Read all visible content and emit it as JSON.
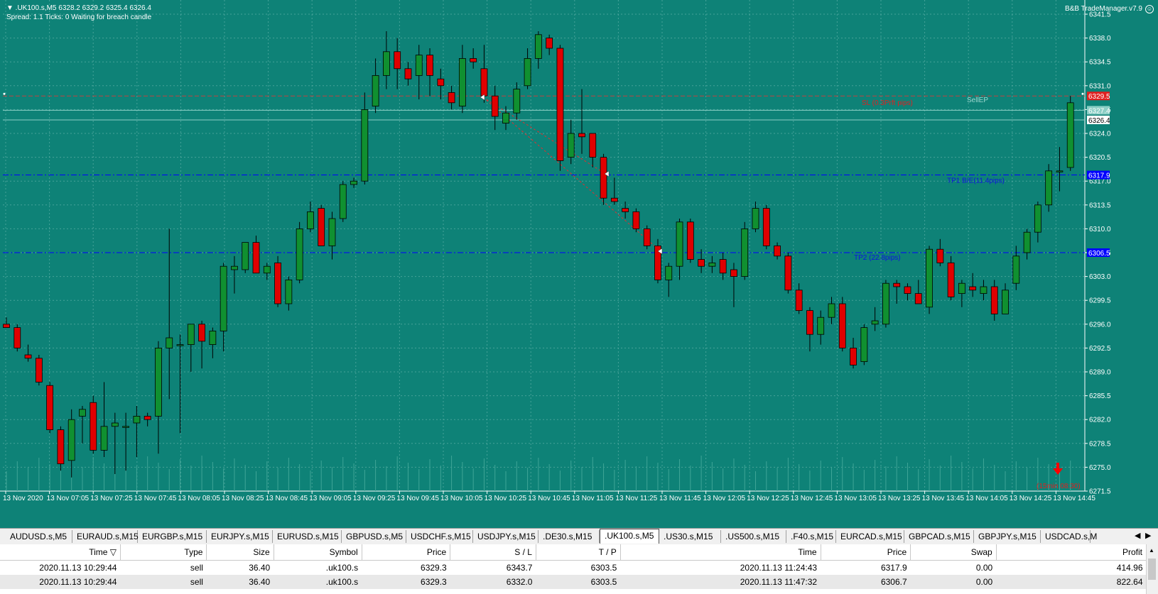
{
  "header": {
    "symbol_line": "▼ .UK100.s,M5  6328.2 6329.2 6325.4 6326.4",
    "status_line": "Spread: 1.1  Ticks: 0  Waiting for breach candle",
    "ea_title": "B&B TradeManager.v7.9"
  },
  "colors": {
    "background": "#0e8277",
    "bull": "#109030",
    "bear": "#e00000",
    "grid": "#5fb0a8",
    "sl_line": "#c04040",
    "tp_line": "#0000ff",
    "label_sl": "#e02020",
    "label_tp": "#1010e0"
  },
  "chart_data": {
    "type": "candlestick",
    "symbol": ".UK100.s",
    "timeframe": "M5",
    "y_ticks": [
      "6341.5",
      "6338.0",
      "6334.5",
      "6331.0",
      "6327.5",
      "6324.0",
      "6320.5",
      "6317.0",
      "6313.5",
      "6310.0",
      "6306.5",
      "6303.0",
      "6299.5",
      "6296.0",
      "6292.5",
      "6289.0",
      "6285.5",
      "6282.0",
      "6278.5",
      "6275.0",
      "6271.5"
    ],
    "x_ticks": [
      "13 Nov 2020",
      "13 Nov 07:05",
      "13 Nov 07:25",
      "13 Nov 07:45",
      "13 Nov 08:05",
      "13 Nov 08:25",
      "13 Nov 08:45",
      "13 Nov 09:05",
      "13 Nov 09:25",
      "13 Nov 09:45",
      "13 Nov 10:05",
      "13 Nov 10:25",
      "13 Nov 10:45",
      "13 Nov 11:05",
      "13 Nov 11:25",
      "13 Nov 11:45",
      "13 Nov 12:05",
      "13 Nov 12:25",
      "13 Nov 12:45",
      "13 Nov 13:05",
      "13 Nov 13:25",
      "13 Nov 13:45",
      "13 Nov 14:05",
      "13 Nov 14:25",
      "13 Nov 14:45"
    ],
    "ylim": [
      6271.5,
      6341.5
    ],
    "candles": [
      {
        "o": 6296.0,
        "h": 6297.0,
        "l": 6295.5,
        "c": 6295.5
      },
      {
        "o": 6295.5,
        "h": 6296.0,
        "l": 6292.0,
        "c": 6292.5
      },
      {
        "o": 6291.5,
        "h": 6293.0,
        "l": 6290.5,
        "c": 6291.0
      },
      {
        "o": 6291.0,
        "h": 6291.5,
        "l": 6287.0,
        "c": 6287.5
      },
      {
        "o": 6287.0,
        "h": 6287.5,
        "l": 6280.0,
        "c": 6280.5
      },
      {
        "o": 6280.5,
        "h": 6281.0,
        "l": 6274.5,
        "c": 6275.5
      },
      {
        "o": 6276.0,
        "h": 6283.5,
        "l": 6273.5,
        "c": 6282.0
      },
      {
        "o": 6282.5,
        "h": 6284.0,
        "l": 6278.5,
        "c": 6283.5
      },
      {
        "o": 6284.5,
        "h": 6285.5,
        "l": 6277.0,
        "c": 6277.5
      },
      {
        "o": 6277.5,
        "h": 6287.5,
        "l": 6276.5,
        "c": 6281.0
      },
      {
        "o": 6281.0,
        "h": 6283.0,
        "l": 6274.0,
        "c": 6281.5
      },
      {
        "o": 6281.0,
        "h": 6283.0,
        "l": 6274.5,
        "c": 6281.0
      },
      {
        "o": 6281.5,
        "h": 6284.0,
        "l": 6276.5,
        "c": 6282.5
      },
      {
        "o": 6282.5,
        "h": 6283.0,
        "l": 6281.0,
        "c": 6282.0
      },
      {
        "o": 6282.5,
        "h": 6293.5,
        "l": 6277.0,
        "c": 6292.5
      },
      {
        "o": 6292.5,
        "h": 6310.0,
        "l": 6285.0,
        "c": 6294.0
      },
      {
        "o": 6293.0,
        "h": 6294.5,
        "l": 6280.0,
        "c": 6293.0
      },
      {
        "o": 6293.0,
        "h": 6296.0,
        "l": 6289.0,
        "c": 6296.0
      },
      {
        "o": 6296.0,
        "h": 6296.5,
        "l": 6289.5,
        "c": 6293.5
      },
      {
        "o": 6293.0,
        "h": 6295.5,
        "l": 6291.0,
        "c": 6295.0
      },
      {
        "o": 6295.0,
        "h": 6305.0,
        "l": 6292.0,
        "c": 6304.5
      },
      {
        "o": 6304.0,
        "h": 6306.0,
        "l": 6300.5,
        "c": 6304.5
      },
      {
        "o": 6304.0,
        "h": 6307.5,
        "l": 6303.5,
        "c": 6308.0
      },
      {
        "o": 6308.0,
        "h": 6309.0,
        "l": 6303.5,
        "c": 6303.5
      },
      {
        "o": 6303.5,
        "h": 6305.0,
        "l": 6302.5,
        "c": 6304.5
      },
      {
        "o": 6305.0,
        "h": 6306.0,
        "l": 6298.5,
        "c": 6299.0
      },
      {
        "o": 6299.0,
        "h": 6303.0,
        "l": 6298.0,
        "c": 6302.5
      },
      {
        "o": 6302.5,
        "h": 6311.0,
        "l": 6302.0,
        "c": 6310.0
      },
      {
        "o": 6310.0,
        "h": 6314.0,
        "l": 6309.5,
        "c": 6312.5
      },
      {
        "o": 6313.0,
        "h": 6313.5,
        "l": 6307.5,
        "c": 6307.5
      },
      {
        "o": 6307.5,
        "h": 6312.5,
        "l": 6305.5,
        "c": 6311.5
      },
      {
        "o": 6311.5,
        "h": 6317.0,
        "l": 6311.0,
        "c": 6316.5
      },
      {
        "o": 6316.5,
        "h": 6317.5,
        "l": 6316.0,
        "c": 6317.0
      },
      {
        "o": 6317.0,
        "h": 6330.0,
        "l": 6316.5,
        "c": 6327.5
      },
      {
        "o": 6328.0,
        "h": 6335.0,
        "l": 6327.0,
        "c": 6332.5
      },
      {
        "o": 6332.5,
        "h": 6339.0,
        "l": 6330.5,
        "c": 6336.0
      },
      {
        "o": 6336.0,
        "h": 6338.0,
        "l": 6330.5,
        "c": 6333.5
      },
      {
        "o": 6333.5,
        "h": 6334.5,
        "l": 6331.0,
        "c": 6332.0
      },
      {
        "o": 6332.5,
        "h": 6337.0,
        "l": 6329.0,
        "c": 6335.5
      },
      {
        "o": 6335.5,
        "h": 6336.5,
        "l": 6329.5,
        "c": 6332.5
      },
      {
        "o": 6332.0,
        "h": 6333.5,
        "l": 6329.0,
        "c": 6331.0
      },
      {
        "o": 6330.0,
        "h": 6331.0,
        "l": 6327.5,
        "c": 6328.5
      },
      {
        "o": 6328.0,
        "h": 6337.0,
        "l": 6327.0,
        "c": 6335.0
      },
      {
        "o": 6335.0,
        "h": 6336.5,
        "l": 6333.5,
        "c": 6334.5
      },
      {
        "o": 6333.5,
        "h": 6337.0,
        "l": 6328.5,
        "c": 6329.5
      },
      {
        "o": 6329.5,
        "h": 6331.0,
        "l": 6324.5,
        "c": 6326.5
      },
      {
        "o": 6325.5,
        "h": 6328.0,
        "l": 6324.5,
        "c": 6327.0
      },
      {
        "o": 6327.0,
        "h": 6331.5,
        "l": 6326.0,
        "c": 6330.5
      },
      {
        "o": 6331.0,
        "h": 6336.5,
        "l": 6330.5,
        "c": 6335.0
      },
      {
        "o": 6335.0,
        "h": 6339.0,
        "l": 6333.5,
        "c": 6338.5
      },
      {
        "o": 6338.0,
        "h": 6338.5,
        "l": 6335.5,
        "c": 6336.5
      },
      {
        "o": 6336.5,
        "h": 6337.0,
        "l": 6318.5,
        "c": 6320.0
      },
      {
        "o": 6320.5,
        "h": 6326.0,
        "l": 6319.5,
        "c": 6324.0
      },
      {
        "o": 6324.0,
        "h": 6330.5,
        "l": 6321.0,
        "c": 6323.5
      },
      {
        "o": 6324.0,
        "h": 6324.0,
        "l": 6319.0,
        "c": 6320.5
      },
      {
        "o": 6320.5,
        "h": 6321.0,
        "l": 6313.5,
        "c": 6314.5
      },
      {
        "o": 6314.5,
        "h": 6317.5,
        "l": 6313.5,
        "c": 6314.0
      },
      {
        "o": 6313.0,
        "h": 6314.0,
        "l": 6311.5,
        "c": 6312.5
      },
      {
        "o": 6312.5,
        "h": 6313.0,
        "l": 6309.5,
        "c": 6310.0
      },
      {
        "o": 6310.0,
        "h": 6310.5,
        "l": 6307.0,
        "c": 6307.5
      },
      {
        "o": 6307.5,
        "h": 6308.5,
        "l": 6302.0,
        "c": 6302.5
      },
      {
        "o": 6302.5,
        "h": 6305.0,
        "l": 6300.0,
        "c": 6304.5
      },
      {
        "o": 6304.5,
        "h": 6311.5,
        "l": 6302.5,
        "c": 6311.0
      },
      {
        "o": 6311.0,
        "h": 6311.5,
        "l": 6305.0,
        "c": 6305.5
      },
      {
        "o": 6305.5,
        "h": 6307.0,
        "l": 6303.5,
        "c": 6304.5
      },
      {
        "o": 6304.5,
        "h": 6306.0,
        "l": 6303.5,
        "c": 6305.0
      },
      {
        "o": 6305.5,
        "h": 6306.5,
        "l": 6302.5,
        "c": 6303.5
      },
      {
        "o": 6304.0,
        "h": 6305.0,
        "l": 6298.5,
        "c": 6303.0
      },
      {
        "o": 6303.0,
        "h": 6311.0,
        "l": 6302.5,
        "c": 6310.0
      },
      {
        "o": 6310.0,
        "h": 6314.0,
        "l": 6309.5,
        "c": 6313.0
      },
      {
        "o": 6313.0,
        "h": 6313.5,
        "l": 6307.0,
        "c": 6307.5
      },
      {
        "o": 6307.5,
        "h": 6308.0,
        "l": 6305.5,
        "c": 6306.0
      },
      {
        "o": 6306.0,
        "h": 6306.5,
        "l": 6300.5,
        "c": 6301.0
      },
      {
        "o": 6301.0,
        "h": 6302.0,
        "l": 6297.5,
        "c": 6298.0
      },
      {
        "o": 6298.0,
        "h": 6298.5,
        "l": 6292.0,
        "c": 6294.5
      },
      {
        "o": 6294.5,
        "h": 6298.0,
        "l": 6293.0,
        "c": 6297.0
      },
      {
        "o": 6297.0,
        "h": 6300.0,
        "l": 6296.0,
        "c": 6299.0
      },
      {
        "o": 6299.0,
        "h": 6300.0,
        "l": 6292.0,
        "c": 6292.5
      },
      {
        "o": 6292.5,
        "h": 6294.0,
        "l": 6289.5,
        "c": 6290.0
      },
      {
        "o": 6290.5,
        "h": 6296.0,
        "l": 6290.0,
        "c": 6295.5
      },
      {
        "o": 6296.0,
        "h": 6298.5,
        "l": 6295.0,
        "c": 6296.5
      },
      {
        "o": 6296.0,
        "h": 6302.5,
        "l": 6295.5,
        "c": 6302.0
      },
      {
        "o": 6302.0,
        "h": 6302.5,
        "l": 6299.0,
        "c": 6301.5
      },
      {
        "o": 6301.5,
        "h": 6302.0,
        "l": 6299.5,
        "c": 6300.5
      },
      {
        "o": 6300.5,
        "h": 6302.5,
        "l": 6299.5,
        "c": 6299.0
      },
      {
        "o": 6298.5,
        "h": 6307.5,
        "l": 6297.5,
        "c": 6307.0
      },
      {
        "o": 6307.0,
        "h": 6308.5,
        "l": 6304.5,
        "c": 6305.0
      },
      {
        "o": 6305.0,
        "h": 6306.0,
        "l": 6299.5,
        "c": 6300.0
      },
      {
        "o": 6300.5,
        "h": 6302.5,
        "l": 6298.5,
        "c": 6302.0
      },
      {
        "o": 6301.5,
        "h": 6303.5,
        "l": 6300.0,
        "c": 6301.0
      },
      {
        "o": 6300.5,
        "h": 6302.5,
        "l": 6299.5,
        "c": 6301.5
      },
      {
        "o": 6301.5,
        "h": 6302.5,
        "l": 6296.5,
        "c": 6297.5
      },
      {
        "o": 6297.5,
        "h": 6302.0,
        "l": 6297.5,
        "c": 6301.0
      },
      {
        "o": 6302.0,
        "h": 6307.5,
        "l": 6301.0,
        "c": 6306.0
      },
      {
        "o": 6306.5,
        "h": 6310.0,
        "l": 6305.5,
        "c": 6309.5
      },
      {
        "o": 6309.5,
        "h": 6314.0,
        "l": 6308.0,
        "c": 6313.5
      },
      {
        "o": 6313.5,
        "h": 6319.5,
        "l": 6312.5,
        "c": 6318.5
      },
      {
        "o": 6318.5,
        "h": 6322.0,
        "l": 6315.5,
        "c": 6318.5
      },
      {
        "o": 6319.0,
        "h": 6329.5,
        "l": 6318.5,
        "c": 6328.5
      }
    ]
  },
  "levels": {
    "sl": {
      "price": 6329.5,
      "label": "SL (0.3Prft pips)",
      "tag": "6329.5"
    },
    "sl_fill": {
      "label": "SellEP"
    },
    "ask": {
      "price": 6327.4,
      "tag": "6327.4"
    },
    "bid": {
      "price": 6326.4,
      "tag": "6326.4"
    },
    "tp1": {
      "price": 6317.9,
      "label": "TP1 B/E(11.4pips)",
      "tag": "6317.9"
    },
    "tp2": {
      "price": 6306.5,
      "label": "TP2 (22.8pips)",
      "tag": "6306.5"
    }
  },
  "countdown": "(15min 08:30)",
  "tabs": [
    {
      "label": "AUDUSD.s,M5",
      "active": false
    },
    {
      "label": "EURAUD.s,M15",
      "active": false
    },
    {
      "label": "EURGBP.s,M15",
      "active": false
    },
    {
      "label": "EURJPY.s,M15",
      "active": false
    },
    {
      "label": "EURUSD.s,M15",
      "active": false
    },
    {
      "label": "GBPUSD.s,M5",
      "active": false
    },
    {
      "label": "USDCHF.s,M15",
      "active": false
    },
    {
      "label": "USDJPY.s,M15",
      "active": false
    },
    {
      "label": ".DE30.s,M15",
      "active": false
    },
    {
      "label": ".UK100.s,M5",
      "active": true
    },
    {
      "label": ".US30.s,M15",
      "active": false
    },
    {
      "label": ".US500.s,M15",
      "active": false
    },
    {
      "label": ".F40.s,M15",
      "active": false
    },
    {
      "label": "EURCAD.s,M15",
      "active": false
    },
    {
      "label": "GBPCAD.s,M15",
      "active": false
    },
    {
      "label": "GBPJPY.s,M15",
      "active": false
    },
    {
      "label": "USDCAD.s,M",
      "active": false
    }
  ],
  "trade_table": {
    "columns": [
      "Time",
      "Type",
      "Size",
      "Symbol",
      "Price",
      "S / L",
      "T / P",
      "Time",
      "Price",
      "Swap",
      "Profit"
    ],
    "sort_indicator": "▽",
    "rows": [
      [
        "2020.11.13 10:29:44",
        "sell",
        "36.40",
        ".uk100.s",
        "6329.3",
        "6343.7",
        "6303.5",
        "2020.11.13 11:24:43",
        "6317.9",
        "0.00",
        "414.96"
      ],
      [
        "2020.11.13 10:29:44",
        "sell",
        "36.40",
        ".uk100.s",
        "6329.3",
        "6332.0",
        "6303.5",
        "2020.11.13 11:47:32",
        "6306.7",
        "0.00",
        "822.64"
      ]
    ]
  }
}
